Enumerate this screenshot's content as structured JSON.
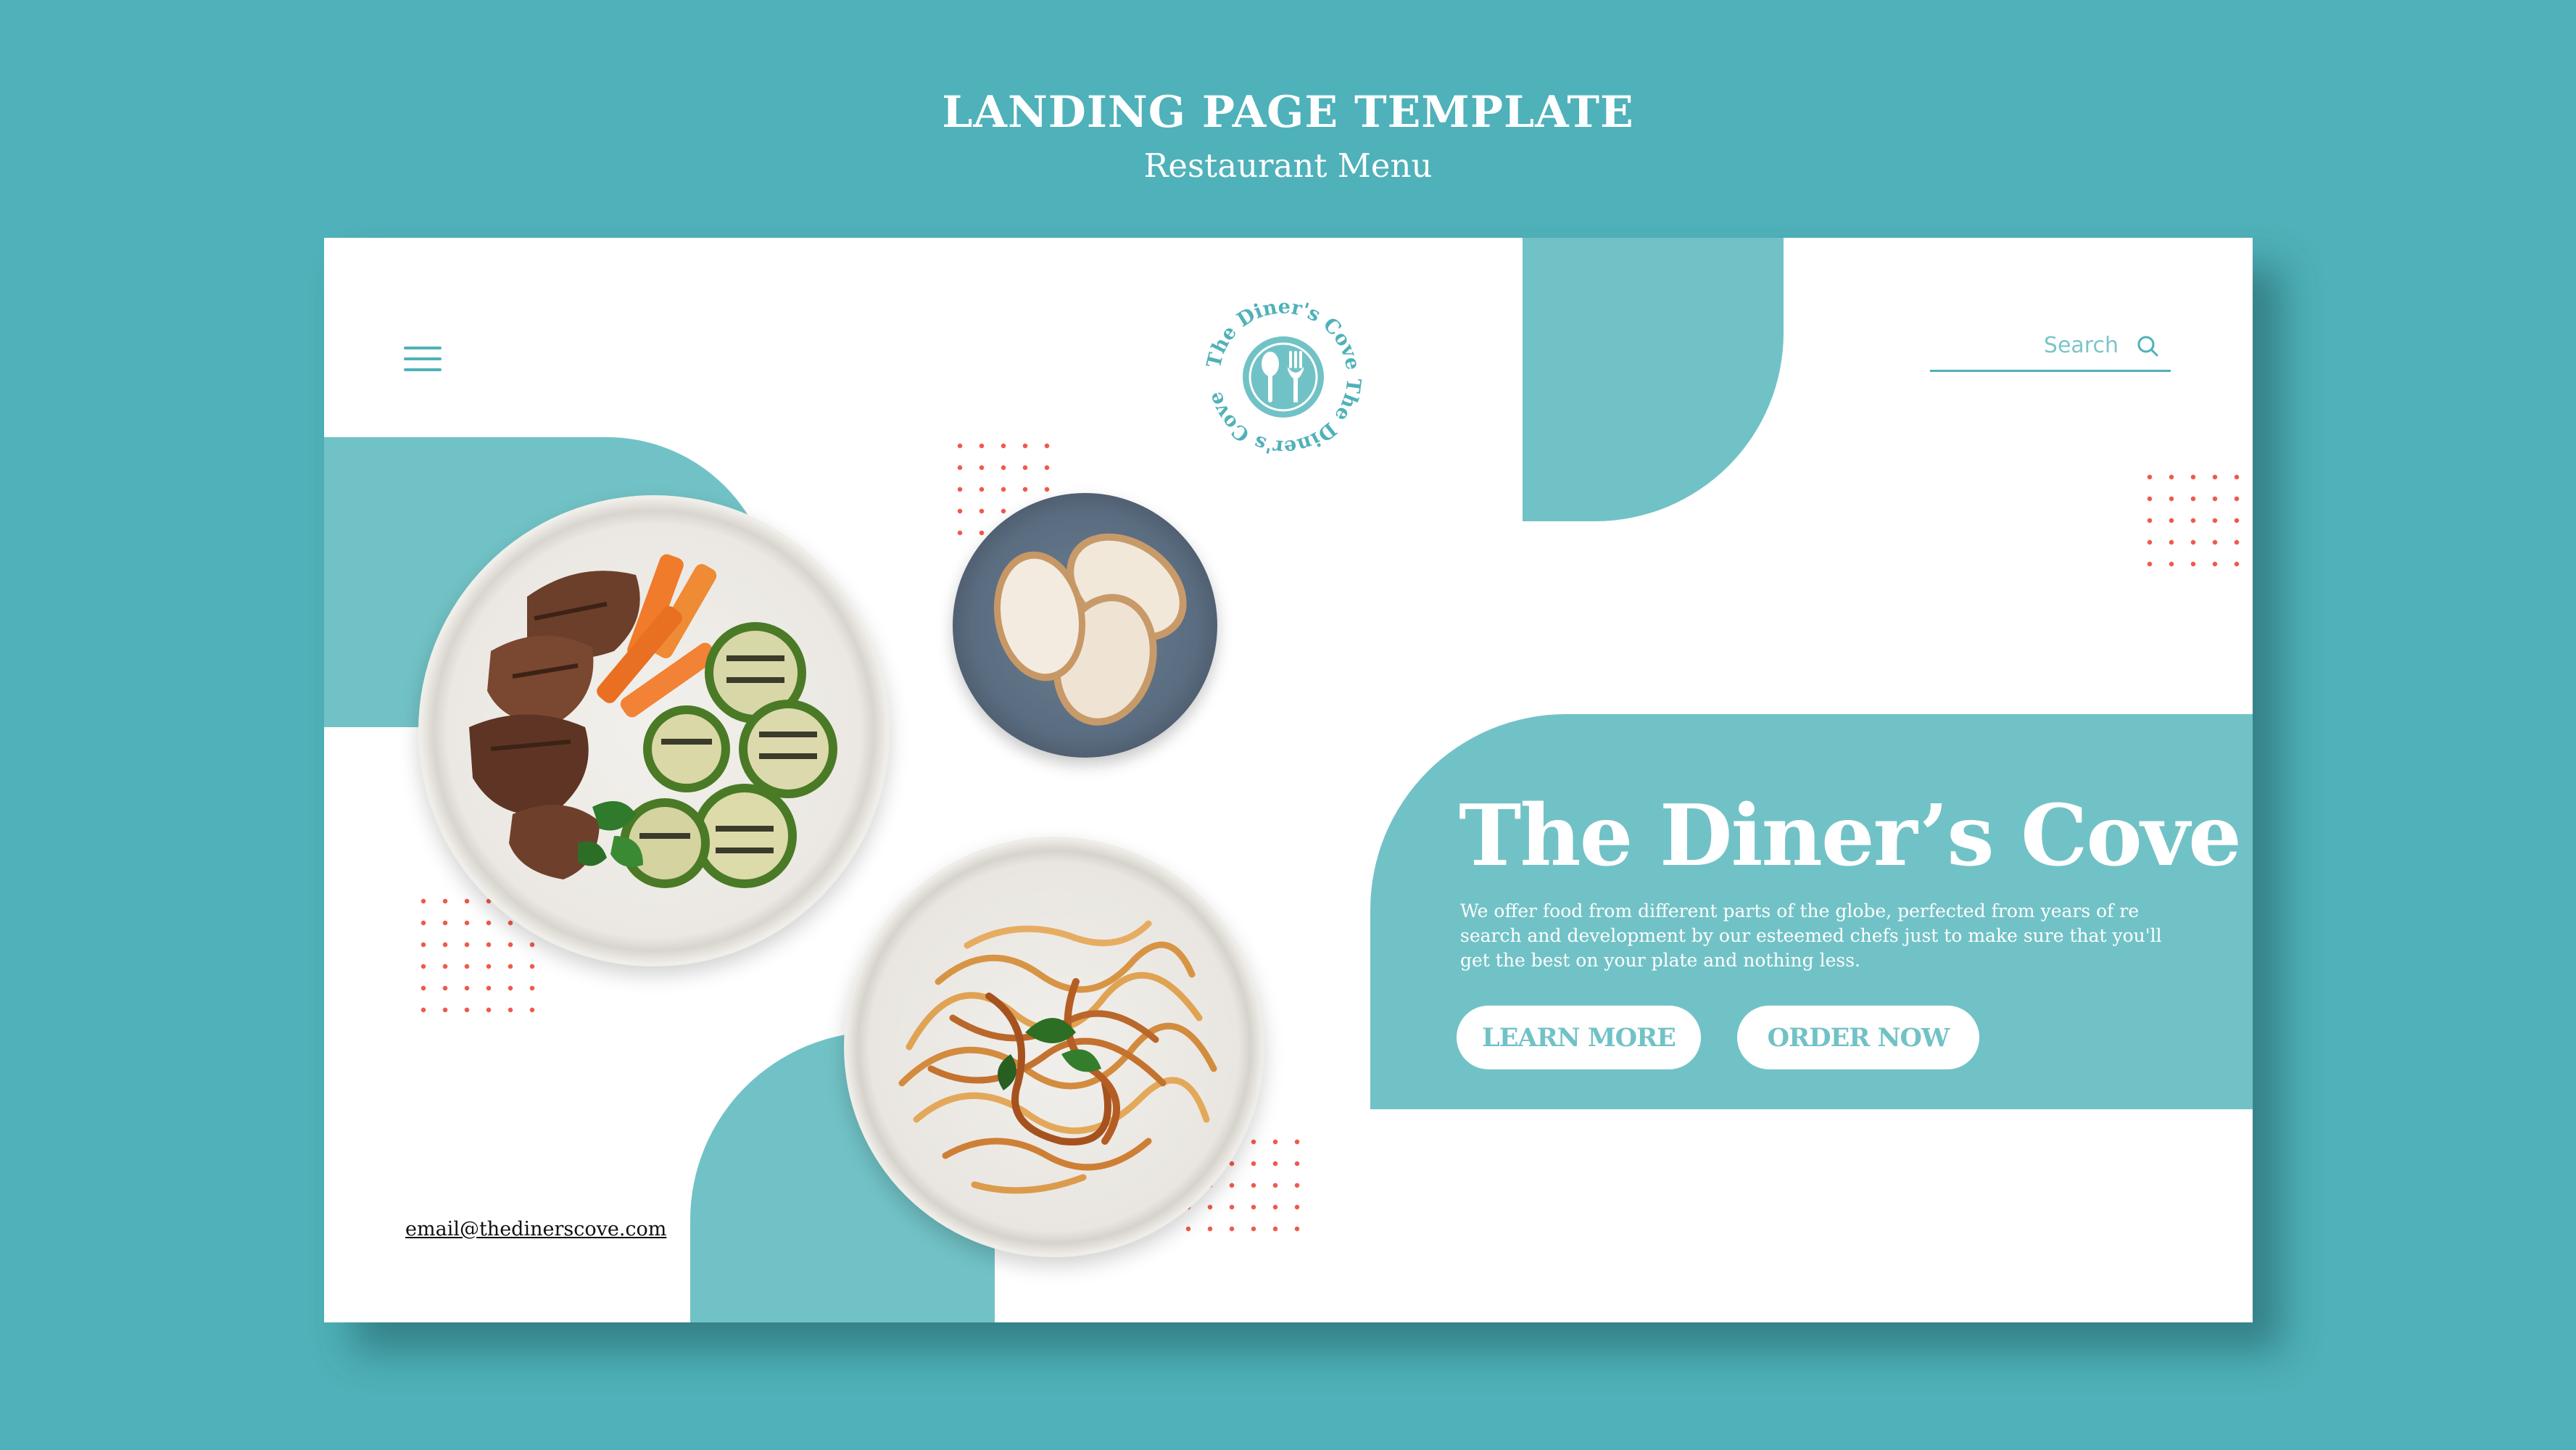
{
  "header": {
    "title": "LANDING PAGE TEMPLATE",
    "subtitle": "Restaurant Menu"
  },
  "nav": {
    "menu_icon": "hamburger-menu-icon",
    "logo": {
      "text": "The Diner's Cove The Diner's Cove",
      "icons": [
        "spoon-icon",
        "fork-icon"
      ]
    },
    "search": {
      "placeholder": "Search",
      "icon": "search-icon"
    }
  },
  "hero": {
    "title": "The Diner’s Cove",
    "description": "We offer food from different parts of the globe, perfected from years of re search and development by our esteemed chefs just to make sure that you'll get the best on your plate and nothing less.",
    "buttons": {
      "learn_more": "LEARN MORE",
      "order_now": "ORDER NOW"
    }
  },
  "footer": {
    "email": "email@thedinerscove.com"
  },
  "colors": {
    "background": "#4fb1b9",
    "accent": "#71c2c6",
    "dots": "#f0584a",
    "card": "#ffffff"
  }
}
